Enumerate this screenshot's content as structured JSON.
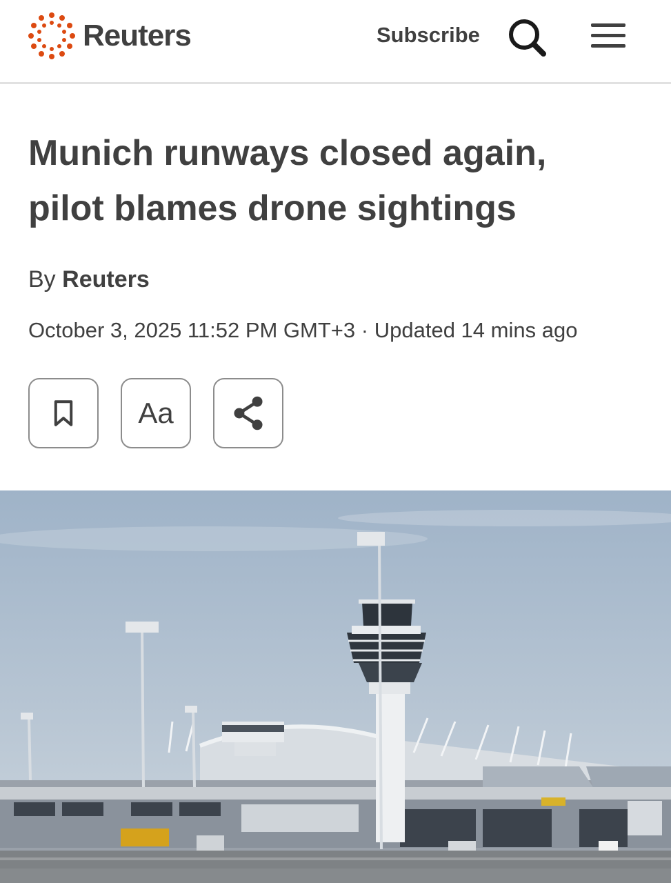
{
  "header": {
    "brand": "Reuters",
    "subscribe_label": "Subscribe",
    "search_icon": "search-icon",
    "menu_icon": "hamburger-menu-icon",
    "brand_color": "#dc4a11"
  },
  "article": {
    "headline_line1": "Munich runways closed again,",
    "headline_line2": "pilot blames drone sightings",
    "byline_prefix": "By",
    "byline_author": "Reuters",
    "timestamp": "October 3, 2025 11:52 PM GMT+3",
    "separator": "·",
    "updated": "Updated 14 mins ago"
  },
  "toolbar": {
    "bookmark_icon": "bookmark-icon",
    "text_size_label": "Aa",
    "share_icon": "share-icon"
  },
  "hero_image": {
    "subject": "airport-control-tower-photo"
  }
}
